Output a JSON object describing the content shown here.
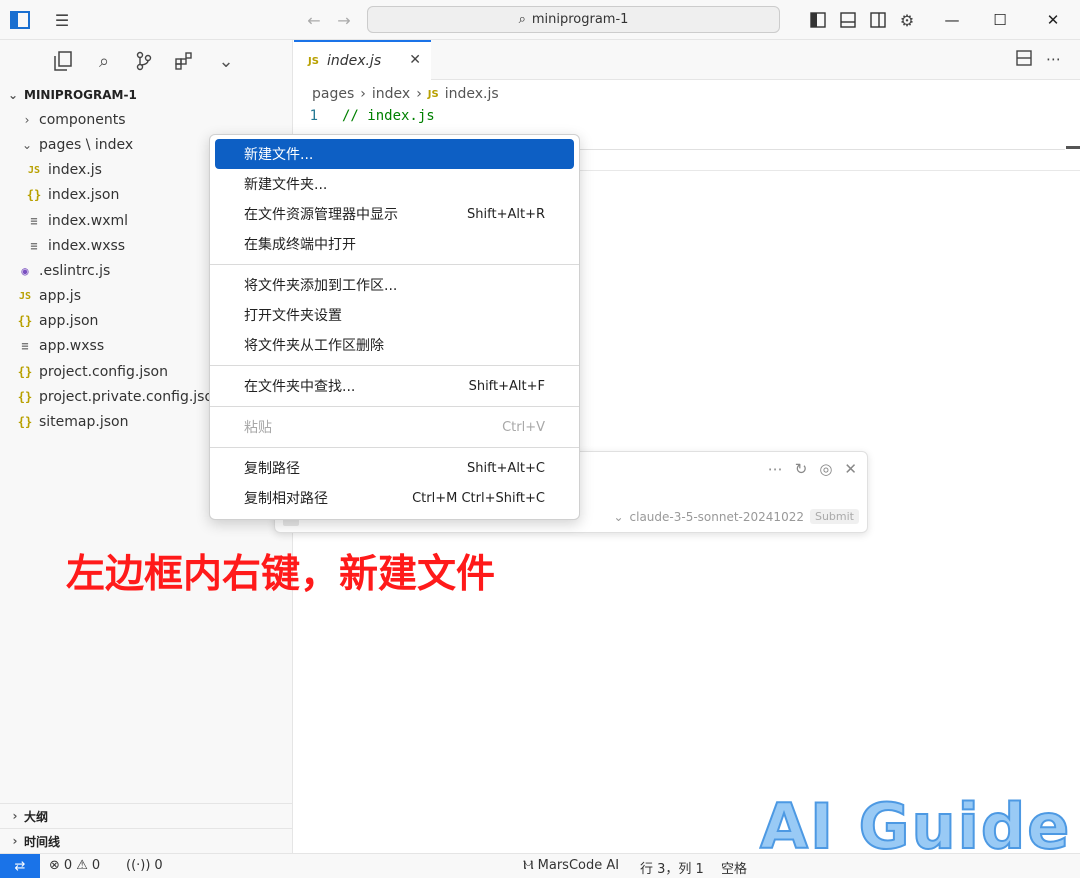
{
  "titlebar": {
    "search_text": "miniprogram-1",
    "back": "←",
    "forward": "→",
    "minimize": "—",
    "maximize": "☐",
    "close": "✕"
  },
  "sidebar": {
    "root": "MINIPROGRAM-1",
    "items": [
      {
        "label": "components",
        "type": "folder",
        "chev": "›"
      },
      {
        "label": "pages \\ index",
        "type": "folder",
        "chev": "⌄"
      },
      {
        "label": "index.js",
        "type": "js",
        "icon": "JS"
      },
      {
        "label": "index.json",
        "type": "json",
        "icon": "{}"
      },
      {
        "label": "index.wxml",
        "type": "lines",
        "icon": "≡"
      },
      {
        "label": "index.wxss",
        "type": "lines",
        "icon": "≡"
      },
      {
        "label": ".eslintrc.js",
        "type": "lint",
        "icon": "◉"
      },
      {
        "label": "app.js",
        "type": "js",
        "icon": "JS"
      },
      {
        "label": "app.json",
        "type": "json",
        "icon": "{}"
      },
      {
        "label": "app.wxss",
        "type": "lines",
        "icon": "≡"
      },
      {
        "label": "project.config.json",
        "type": "json",
        "icon": "{}"
      },
      {
        "label": "project.private.config.json",
        "type": "json",
        "icon": "{}"
      },
      {
        "label": "sitemap.json",
        "type": "json",
        "icon": "{}"
      }
    ],
    "outline": "大纲",
    "timeline": "时间线"
  },
  "editor": {
    "tab_label": "index.js",
    "tab_icon": "JS",
    "breadcrumb": [
      "pages",
      "index",
      "index.js"
    ],
    "code_lines": [
      {
        "num": "1",
        "text": "// index.js"
      }
    ]
  },
  "context_menu": {
    "groups": [
      [
        {
          "label": "新建文件...",
          "shortcut": "",
          "selected": true
        },
        {
          "label": "新建文件夹...",
          "shortcut": ""
        },
        {
          "label": "在文件资源管理器中显示",
          "shortcut": "Shift+Alt+R"
        },
        {
          "label": "在集成终端中打开",
          "shortcut": ""
        }
      ],
      [
        {
          "label": "将文件夹添加到工作区...",
          "shortcut": ""
        },
        {
          "label": "打开文件夹设置",
          "shortcut": ""
        },
        {
          "label": "将文件夹从工作区删除",
          "shortcut": ""
        }
      ],
      [
        {
          "label": "在文件夹中查找...",
          "shortcut": "Shift+Alt+F"
        }
      ],
      [
        {
          "label": "粘贴",
          "shortcut": "Ctrl+V",
          "disabled": true
        }
      ],
      [
        {
          "label": "复制路径",
          "shortcut": "Shift+Alt+C"
        },
        {
          "label": "复制相对路径",
          "shortcut": "Ctrl+M Ctrl+Shift+C"
        }
      ]
    ]
  },
  "ai_panel": {
    "model": "claude-3-5-sonnet-20241022",
    "submit": "Submit"
  },
  "annotation": "左边框内右键，新建文件",
  "watermark": "AI Guide",
  "statusbar": {
    "errors": "0",
    "warnings": "0",
    "ports": "0",
    "marscode": "MarsCode AI",
    "position": "行 3，列 1",
    "spaces": "空格"
  },
  "colors": {
    "accent": "#1a73e8",
    "menu_selected": "#0d5fc4",
    "annotation": "#ff1a1a"
  }
}
